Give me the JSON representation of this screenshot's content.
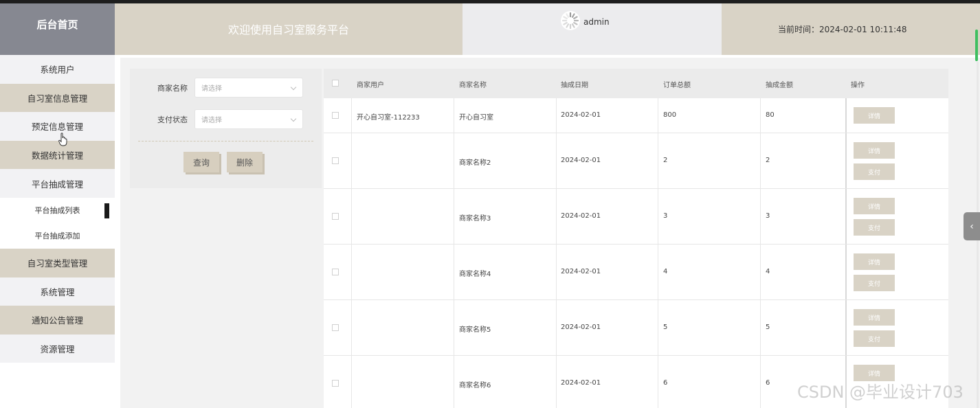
{
  "header": {
    "brand": "后台首页",
    "welcome": "欢迎使用自习室服务平台",
    "username": "admin",
    "time_label": "当前时间：2024-02-01 10:11:48"
  },
  "sidebar": {
    "items": [
      {
        "label": "系统用户"
      },
      {
        "label": "自习室信息管理"
      },
      {
        "label": "预定信息管理"
      },
      {
        "label": "数据统计管理"
      },
      {
        "label": "平台抽成管理"
      },
      {
        "label": "平台抽成列表"
      },
      {
        "label": "平台抽成添加"
      },
      {
        "label": "自习室类型管理"
      },
      {
        "label": "系统管理"
      },
      {
        "label": "通知公告管理"
      },
      {
        "label": "资源管理"
      }
    ]
  },
  "search": {
    "merchant_label": "商家名称",
    "merchant_placeholder": "请选择",
    "pay_label": "支付状态",
    "pay_placeholder": "请选择",
    "query_button": "查询",
    "delete_button": "删除"
  },
  "table": {
    "columns": [
      "商家用户",
      "商家名称",
      "抽成日期",
      "订单总额",
      "抽成金额",
      "操作"
    ],
    "rows": [
      {
        "user": "开心自习室-112233",
        "name": "开心自习室",
        "date": "2024-02-01",
        "total": "800",
        "commission": "80",
        "actions": [
          "详情"
        ]
      },
      {
        "user": "",
        "name": "商家名称2",
        "date": "2024-02-01",
        "total": "2",
        "commission": "2",
        "actions": [
          "详情",
          "支付"
        ]
      },
      {
        "user": "",
        "name": "商家名称3",
        "date": "2024-02-01",
        "total": "3",
        "commission": "3",
        "actions": [
          "详情",
          "支付"
        ]
      },
      {
        "user": "",
        "name": "商家名称4",
        "date": "2024-02-01",
        "total": "4",
        "commission": "4",
        "actions": [
          "详情",
          "支付"
        ]
      },
      {
        "user": "",
        "name": "商家名称5",
        "date": "2024-02-01",
        "total": "5",
        "commission": "5",
        "actions": [
          "详情",
          "支付"
        ]
      },
      {
        "user": "",
        "name": "商家名称6",
        "date": "2024-02-01",
        "total": "6",
        "commission": "6",
        "actions": [
          "详情"
        ]
      }
    ]
  },
  "watermark": "CSDN @毕业设计703",
  "colors": {
    "accent": "#d9d3c6",
    "brand_bg": "#868891",
    "user_bg": "#ececee"
  }
}
